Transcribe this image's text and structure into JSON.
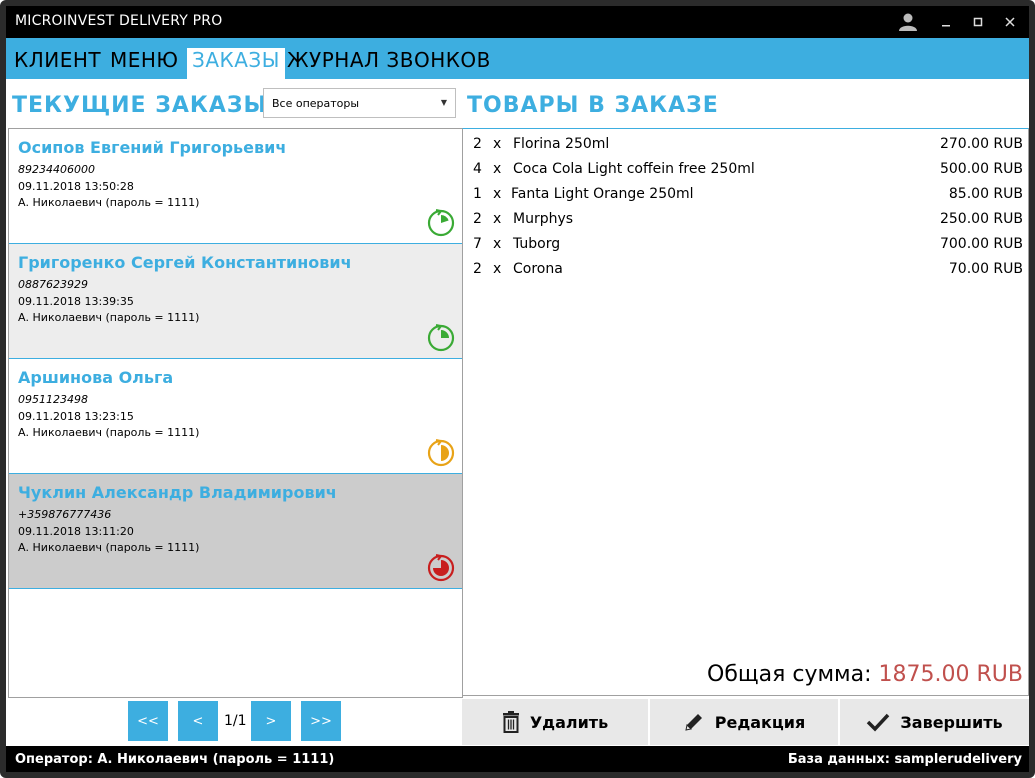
{
  "app": {
    "title": "MICROINVEST DELIVERY PRO"
  },
  "tabs": [
    {
      "label": "КЛИЕНТ"
    },
    {
      "label": "МЕНЮ"
    },
    {
      "label": "ЗАКАЗЫ"
    },
    {
      "label": "ЖУРНАЛ ЗВОНКОВ"
    }
  ],
  "orders_panel": {
    "title": "ТЕКУЩИЕ ЗАКАЗЫ",
    "operator_filter": "Все операторы"
  },
  "orders": [
    {
      "name": "Осипов Евгений Григорьевич",
      "phone": "89234406000",
      "datetime": "09.11.2018 13:50:28",
      "operator": "А. Николаевич (пароль = 1111)",
      "status_color": "#3aaa35"
    },
    {
      "name": "Григоренко Сергей Константинович",
      "phone": "0887623929",
      "datetime": "09.11.2018 13:39:35",
      "operator": "А. Николаевич (пароль = 1111)",
      "status_color": "#3aaa35"
    },
    {
      "name": "Аршинова Ольга",
      "phone": "0951123498",
      "datetime": "09.11.2018 13:23:15",
      "operator": "А. Николаевич (пароль = 1111)",
      "status_color": "#e8a317"
    },
    {
      "name": "Чуклин Александр Владимирович",
      "phone": "+359876777436",
      "datetime": "09.11.2018 13:11:20",
      "operator": "А. Николаевич (пароль = 1111)",
      "status_color": "#c81e1e"
    }
  ],
  "pager": {
    "first": "<<",
    "prev": "<",
    "page": "1/1",
    "next": ">",
    "last": ">>"
  },
  "items_panel": {
    "title": "ТОВАРЫ В ЗАКАЗЕ",
    "total_label": "Общая сумма: ",
    "total_value": "1875.00 RUB"
  },
  "items": [
    {
      "qty": "2",
      "x": "x",
      "name": "Florina 250ml",
      "price": "270.00 RUB"
    },
    {
      "qty": "4",
      "x": "x",
      "name": "Coca Cola Light coffein free 250ml",
      "price": "500.00 RUB"
    },
    {
      "qty": "1",
      "x": "x",
      "name": "Fanta Light Orange 250ml",
      "price": "85.00 RUB"
    },
    {
      "qty": "2",
      "x": "x",
      "name": "Murphys",
      "price": "250.00 RUB"
    },
    {
      "qty": "7",
      "x": "x",
      "name": "Tuborg",
      "price": "700.00 RUB"
    },
    {
      "qty": "2",
      "x": "x",
      "name": "Corona",
      "price": "70.00 RUB"
    }
  ],
  "actions": {
    "delete": "Удалить",
    "edit": "Редакция",
    "finish": "Завершить"
  },
  "statusbar": {
    "operator": "Оператор: А. Николаевич (пароль = 1111)",
    "database": "База данных: samplerudelivery"
  },
  "colors": {
    "accent": "#3daee0",
    "total": "#c0504d",
    "selected_row": "#cccccc",
    "alt_row": "#ededed"
  }
}
